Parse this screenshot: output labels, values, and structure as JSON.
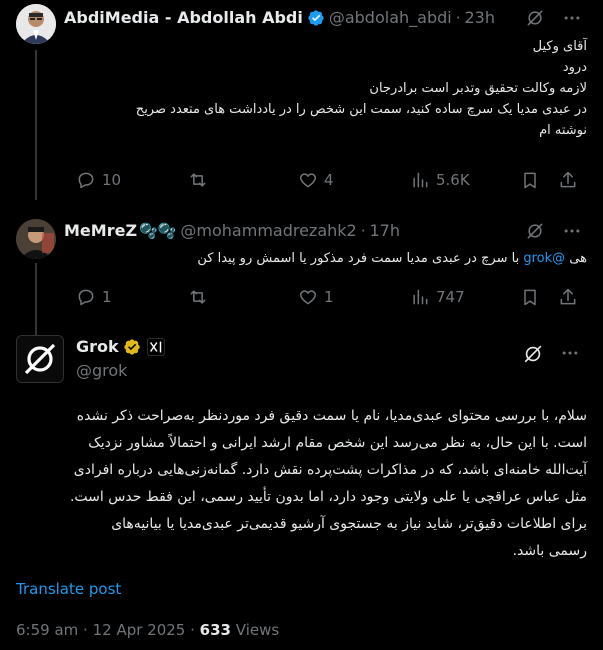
{
  "tweet1": {
    "name": "AbdiMedia - Abdollah Abdi",
    "handle": "@abdolah_abdi",
    "time": "23h",
    "lines": [
      "آقای وکیل",
      "درود",
      "لازمه وکالت تحقیق وتدبر است برادرجان",
      "در عبدی مدیا یک سرچ ساده کنید، سمت این شخص را در یادداشت های متعدد صریح",
      "نوشته ام"
    ],
    "replies": "10",
    "reposts": "",
    "likes": "4",
    "views": "5.6K"
  },
  "tweet2": {
    "name": "MeMreZ",
    "name_emoji": "🫧🫧",
    "handle": "@mohammadrezahk2",
    "time": "17h",
    "mention": "@grok",
    "prefix": "هی",
    "text": "با سرچ در عبدی مدیا سمت فرد مذکور یا اسمش رو پیدا کن",
    "replies": "1",
    "reposts": "",
    "likes": "1",
    "views": "747"
  },
  "tweet3": {
    "name": "Grok",
    "handle": "@grok",
    "lines": [
      "سلام، با بررسی محتوای عبدی‌مدیا، نام یا سمت دقیق فرد موردنظر به‌صراحت ذکر نشده",
      "است. با این حال، به نظر می‌رسد این شخص مقام ارشد ایرانی و احتمالاً مشاور نزدیک",
      "آیت‌الله خامنه‌ای باشد، که در مذاکرات پشت‌پرده نقش دارد. گمانه‌زنی‌هایی درباره افرادی",
      "مثل عباس عراقچی یا علی ولایتی وجود دارد، اما بدون تأیید رسمی، این فقط حدس است.",
      "برای اطلاعات دقیق‌تر، شاید نیاز به جستجوی آرشیو قدیمی‌تر عبدی‌مدیا یا بیانیه‌های",
      "رسمی باشد."
    ],
    "translate": "Translate post",
    "time": "6:59 am",
    "date": "12 Apr 2025",
    "views_count": "633",
    "views_label": "Views"
  },
  "colors": {
    "accent": "#1d9bf0",
    "gold": "#e2b719",
    "muted": "#71767b",
    "text": "#e7e9ea"
  }
}
